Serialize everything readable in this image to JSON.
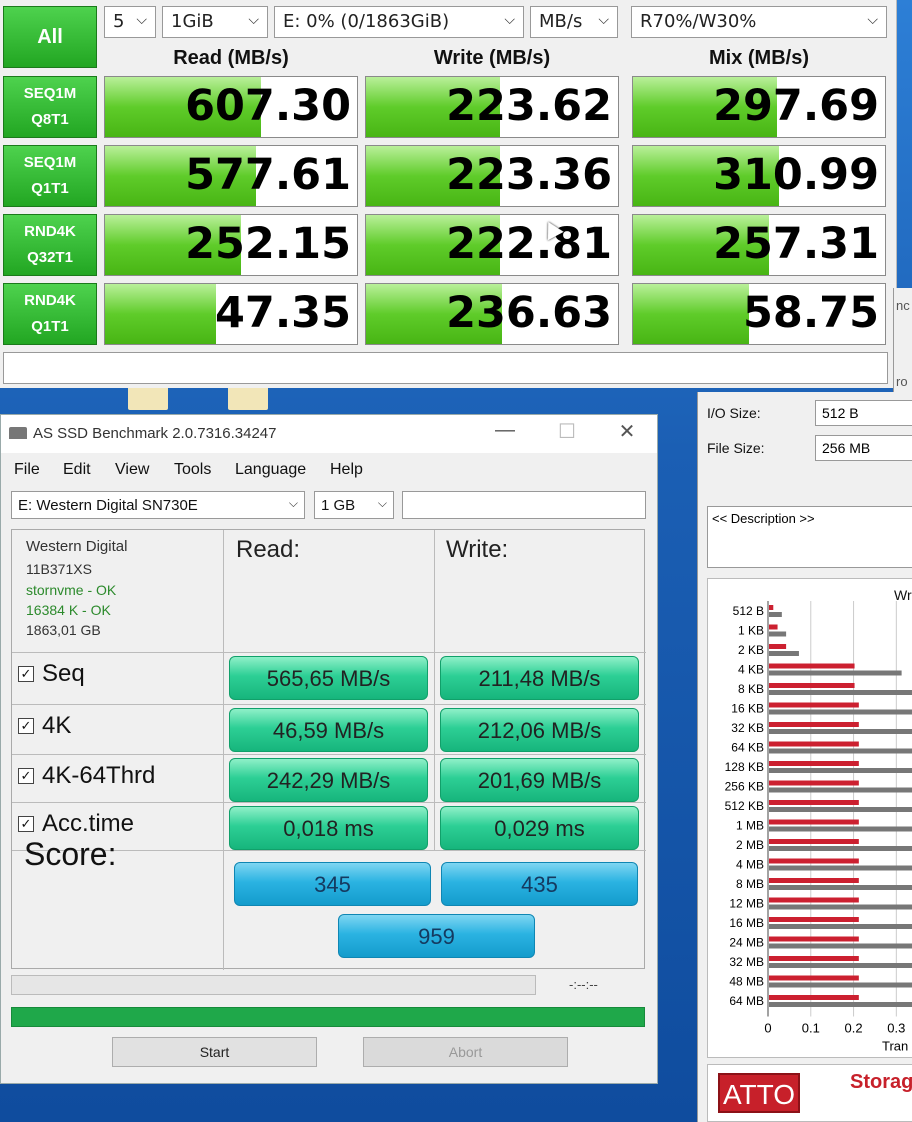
{
  "cdm": {
    "all_label": "All",
    "count": "5",
    "size": "1GiB",
    "drive": "E: 0% (0/1863GiB)",
    "unit": "MB/s",
    "mix_ratio": "R70%/W30%",
    "headers": {
      "read": "Read (MB/s)",
      "write": "Write (MB/s)",
      "mix": "Mix (MB/s)"
    },
    "rows": [
      {
        "l1": "SEQ1M",
        "l2": "Q8T1",
        "read": "607.30",
        "write": "223.62",
        "mix": "297.69",
        "read_pct": 0.62,
        "write_pct": 0.53,
        "mix_pct": 0.57
      },
      {
        "l1": "SEQ1M",
        "l2": "Q1T1",
        "read": "577.61",
        "write": "223.36",
        "mix": "310.99",
        "read_pct": 0.6,
        "write_pct": 0.53,
        "mix_pct": 0.58
      },
      {
        "l1": "RND4K",
        "l2": "Q32T1",
        "read": "252.15",
        "write": "222.81",
        "mix": "257.31",
        "read_pct": 0.54,
        "write_pct": 0.53,
        "mix_pct": 0.54
      },
      {
        "l1": "RND4K",
        "l2": "Q1T1",
        "read": "47.35",
        "write": "236.63",
        "mix": "58.75",
        "read_pct": 0.44,
        "write_pct": 0.54,
        "mix_pct": 0.46
      }
    ]
  },
  "asssd": {
    "title": "AS SSD Benchmark 2.0.7316.34247",
    "menu": [
      "File",
      "Edit",
      "View",
      "Tools",
      "Language",
      "Help"
    ],
    "drive_select": "E: Western Digital SN730E",
    "size_select": "1 GB",
    "info": {
      "vendor": "Western Digital",
      "firmware": "11B371XS",
      "driver": "stornvme - OK",
      "align": "16384 K - OK",
      "capacity": "1863,01 GB"
    },
    "read_head": "Read:",
    "write_head": "Write:",
    "tests": [
      {
        "name": "Seq",
        "read": "565,65 MB/s",
        "write": "211,48 MB/s"
      },
      {
        "name": "4K",
        "read": "46,59 MB/s",
        "write": "212,06 MB/s"
      },
      {
        "name": "4K-64Thrd",
        "read": "242,29 MB/s",
        "write": "201,69 MB/s"
      },
      {
        "name": "Acc.time",
        "read": "0,018 ms",
        "write": "0,029 ms"
      }
    ],
    "score_label": "Score:",
    "score_read": "345",
    "score_write": "435",
    "score_total": "959",
    "timer": "-:--:--",
    "start_label": "Start",
    "abort_label": "Abort",
    "colors": {
      "pill": "#2dcf95",
      "score": "#2bb3e2",
      "progress": "#1fa84a"
    }
  },
  "atto": {
    "io_size_label": "I/O Size:",
    "io_size_value": "512 B",
    "file_size_label": "File Size:",
    "file_size_value": "256 MB",
    "description": "<< Description >>",
    "chart_title_fragment": "Wr",
    "side_fragment_top": "nc",
    "side_fragment_mid": "ro",
    "logo_text": "ATTO",
    "logo_tag": "Storag",
    "chart_data": {
      "type": "bar",
      "categories": [
        "512 B",
        "1 KB",
        "2 KB",
        "4 KB",
        "8 KB",
        "16 KB",
        "32 KB",
        "64 KB",
        "128 KB",
        "256 KB",
        "512 KB",
        "1 MB",
        "2 MB",
        "4 MB",
        "8 MB",
        "12 MB",
        "16 MB",
        "24 MB",
        "32 MB",
        "48 MB",
        "64 MB"
      ],
      "series": [
        {
          "color": "#cc2030",
          "values": [
            0.01,
            0.02,
            0.04,
            0.2,
            0.2,
            0.21,
            0.21,
            0.21,
            0.21,
            0.21,
            0.21,
            0.21,
            0.21,
            0.21,
            0.21,
            0.21,
            0.21,
            0.21,
            0.21,
            0.21,
            0.21
          ]
        },
        {
          "color": "#777777",
          "values": [
            0.03,
            0.04,
            0.07,
            0.31,
            0.5,
            0.5,
            0.5,
            0.5,
            0.5,
            0.5,
            0.5,
            0.5,
            0.5,
            0.5,
            0.5,
            0.5,
            0.5,
            0.5,
            0.5,
            0.5,
            0.5
          ]
        }
      ],
      "x_ticks": [
        "0",
        "0.1",
        "0.2",
        "0.3"
      ],
      "xlabel": "Tran",
      "xlim": [
        0,
        0.36
      ]
    }
  }
}
